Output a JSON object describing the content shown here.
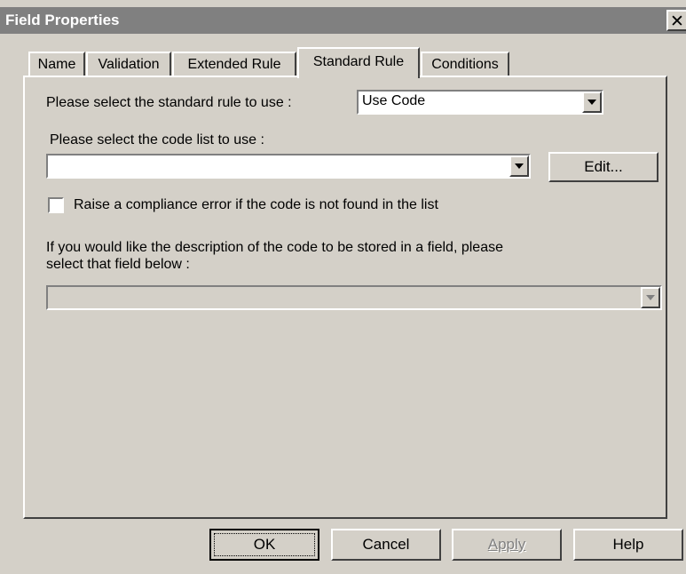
{
  "window": {
    "title": "Field Properties",
    "close_glyph": "✕"
  },
  "tabs": [
    {
      "label": "Name"
    },
    {
      "label": "Validation"
    },
    {
      "label": "Extended Rule"
    },
    {
      "label": "Standard Rule",
      "active": true
    },
    {
      "label": "Conditions"
    }
  ],
  "standard_rule": {
    "label": "Please select the standard rule to use :",
    "value": "Use Code"
  },
  "code_list": {
    "label": "Please select the code list to use :",
    "value": "",
    "edit_label": "Edit..."
  },
  "compliance": {
    "label": "Raise a compliance error if the code is not found in the list",
    "checked": false
  },
  "description": {
    "label_line1": "If you would like the description of the code to be stored in a field, please",
    "label_line2": "select that field below :",
    "value": ""
  },
  "buttons": {
    "ok": "OK",
    "cancel": "Cancel",
    "apply": "Apply",
    "help": "Help"
  }
}
